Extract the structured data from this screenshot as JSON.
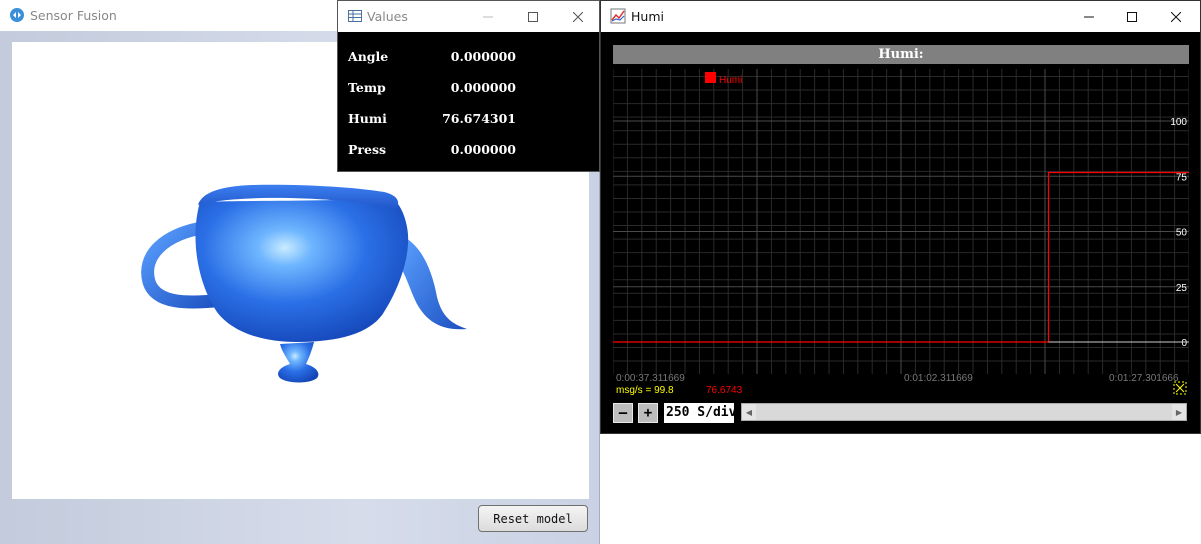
{
  "sensor_fusion": {
    "title": "Sensor Fusion",
    "icon": "sensor-fusion-app-icon",
    "reset_label": "Reset model"
  },
  "values_window": {
    "title": "Values",
    "icon": "table-window-icon",
    "rows": [
      {
        "name": "Angle",
        "value": "0.000000"
      },
      {
        "name": "Temp",
        "value": "0.000000"
      },
      {
        "name": "Humi",
        "value": "76.674301"
      },
      {
        "name": "Press",
        "value": "0.000000"
      }
    ]
  },
  "humi_window": {
    "title": "Humi",
    "icon": "chart-window-icon",
    "plot_title": "Humi:",
    "rate_text": "msg/s = 99.8",
    "current_value": "76.6743",
    "div_label": "250 S/div",
    "minus_label": "–",
    "plus_label": "+",
    "time_labels": [
      "0:00:37.311669",
      "0:01:02.311669",
      "0:01:27.301666"
    ]
  },
  "colors": {
    "series": "#ff0000",
    "plot_bg": "#000000",
    "teapot": "#2a6ae8",
    "rate_text": "#ffff00"
  },
  "chart_data": {
    "type": "line",
    "title": "Humi:",
    "series": [
      {
        "name": "Humi",
        "x": [
          0,
          0.756,
          0.756,
          1.0
        ],
        "values": [
          0,
          0,
          76.6743,
          76.6743
        ]
      }
    ],
    "yticks": [
      0,
      25,
      50,
      75,
      100
    ],
    "ylim": [
      -2,
      105
    ],
    "xlabels": [
      "0:00:37.311669",
      "0:01:02.311669",
      "0:01:27.301666"
    ],
    "grid": true,
    "legend": "top-left"
  }
}
